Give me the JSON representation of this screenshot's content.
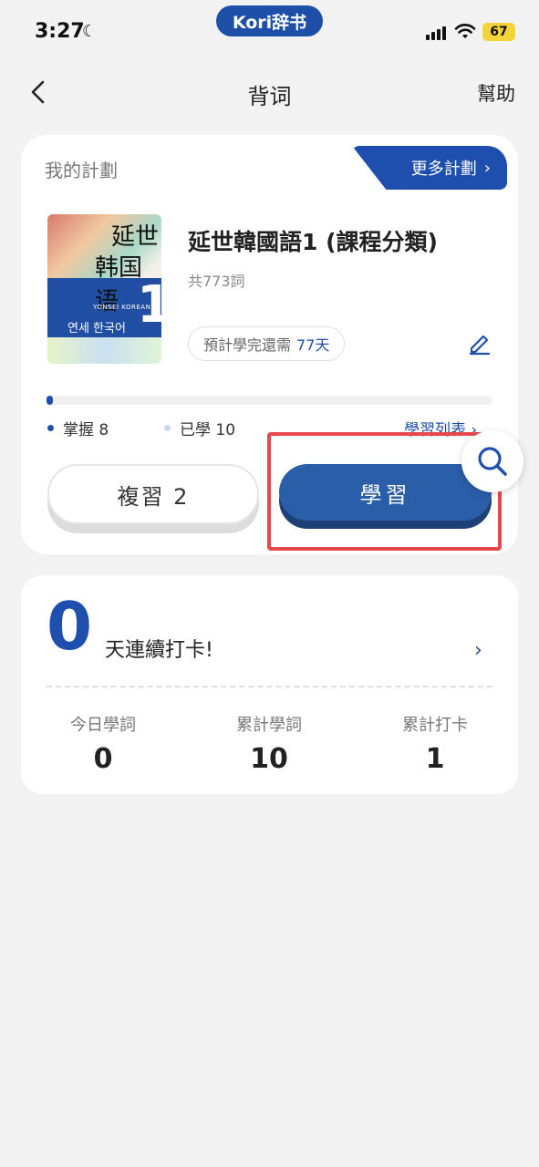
{
  "status_bar": {
    "time": "3:27",
    "app_name": "Kori辞书",
    "battery": "67"
  },
  "header": {
    "title": "背词",
    "help": "幫助"
  },
  "plan": {
    "section_label": "我的計劃",
    "more_plans": "更多計劃",
    "book_title": "延世韓國語1 (課程分類)",
    "word_count": "共773詞",
    "estimate_prefix": "預計學完還需",
    "estimate_days": "77天",
    "progress_fraction": 0.015,
    "mastered_label": "掌握 8",
    "learned_label": "已學 10",
    "study_list": "學習列表",
    "review_button": "複習 2",
    "study_button": "學習",
    "cover": {
      "line1": "延世",
      "line2": "韩国语",
      "korean": "연세 한국어",
      "english": "YONSEI KOREAN",
      "number": "1"
    }
  },
  "streak": {
    "days": "0",
    "label": "天連續打卡!",
    "stats": [
      {
        "label": "今日學詞",
        "value": "0"
      },
      {
        "label": "累計學詞",
        "value": "10"
      },
      {
        "label": "累計打卡",
        "value": "1"
      }
    ]
  },
  "colors": {
    "accent": "#1f4fae",
    "study_button": "#2a5ea8",
    "highlight": "#e5484d",
    "background": "#f2f2f2"
  }
}
